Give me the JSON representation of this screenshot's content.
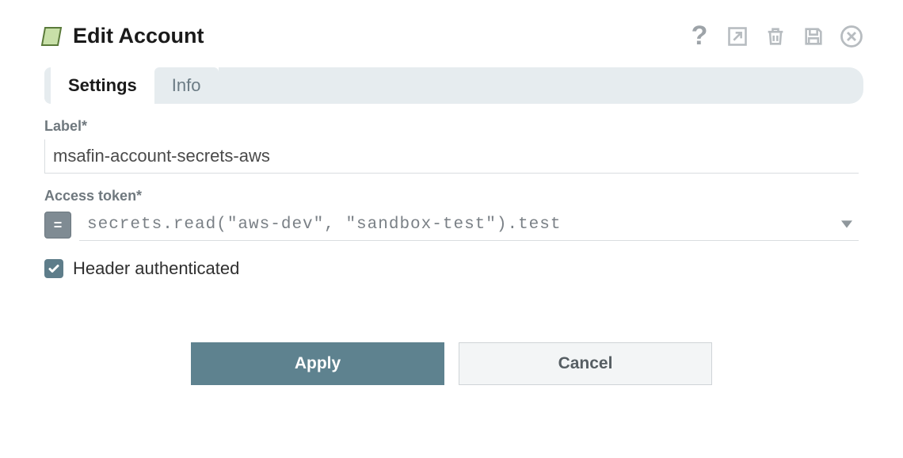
{
  "header": {
    "title": "Edit Account",
    "icons": {
      "help": "?",
      "export": "export-icon",
      "delete": "trash-icon",
      "save": "save-icon",
      "close": "close-icon"
    }
  },
  "tabs": {
    "settings": "Settings",
    "info": "Info"
  },
  "form": {
    "label_field": {
      "label": "Label*",
      "value": "msafin-account-secrets-aws"
    },
    "access_token_field": {
      "label": "Access token*",
      "expr_toggle": "=",
      "value": "secrets.read(\"aws-dev\", \"sandbox-test\").test"
    },
    "header_auth": {
      "checked": true,
      "label": "Header authenticated"
    }
  },
  "buttons": {
    "apply": "Apply",
    "cancel": "Cancel"
  }
}
